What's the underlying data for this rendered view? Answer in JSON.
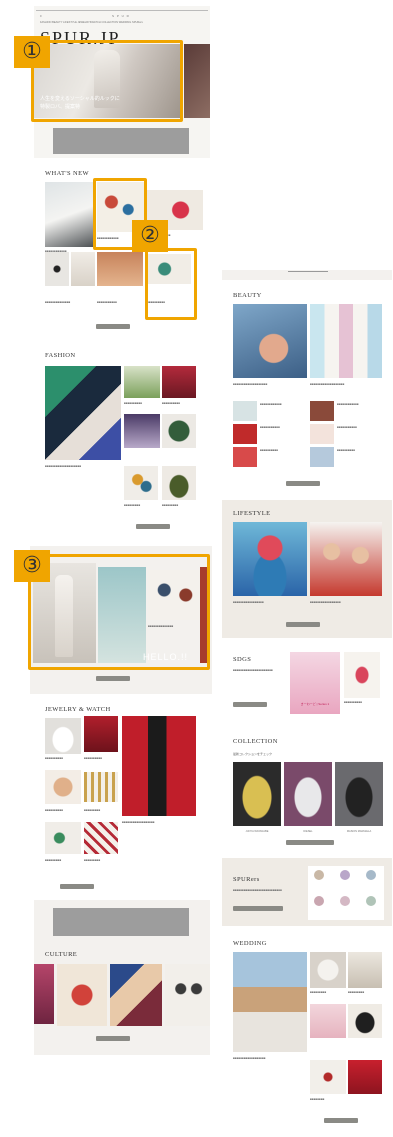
{
  "site": {
    "logo": "SPUR.JP",
    "nav_text": "FASHION BEAUTY LIFESTYLE JEWELRY&WATCH COLLECTION WEDDING SPURers"
  },
  "hero": {
    "caption_line1": "人生を変えるソーシャル的ルックに",
    "caption_line2": "特製ロバ、提案特"
  },
  "whats_new": {
    "title": "WHAT'S NEW",
    "more_label": "VIEW ALL"
  },
  "fashion": {
    "title": "FASHION",
    "more_label": "VIEW ALL"
  },
  "hello": {
    "overlay_text": "HELLO.!!",
    "more_label": "VIEW ALL"
  },
  "jewelry": {
    "title": "JEWELRY & WATCH",
    "more_label": "VIEW ALL"
  },
  "culture": {
    "title": "CULTURE",
    "more_label": "VIEW ALL"
  },
  "beauty": {
    "title": "BEAUTY",
    "more_label": "VIEW ALL"
  },
  "lifestyle": {
    "title": "LIFESTYLE",
    "more_label": "VIEW ALL"
  },
  "sdgs": {
    "title": "SDGS",
    "poster_text": "きーわーど | Series 1"
  },
  "collection": {
    "title": "COLLECTION",
    "subtitle": "最新コレクションをチェック",
    "labels": [
      "JUNYA WATANABE",
      "DIESEL",
      "MAISON MARGIELA"
    ]
  },
  "spurers": {
    "title": "SPURers"
  },
  "wedding": {
    "title": "WEDDING",
    "more_label": "VIEW ALL"
  },
  "annotations": {
    "one": "①",
    "two": "②",
    "three": "③"
  },
  "colors": {
    "annotation": "#f0a500",
    "button": "#8a8a85",
    "soft_bg": "#f3f1ee"
  }
}
